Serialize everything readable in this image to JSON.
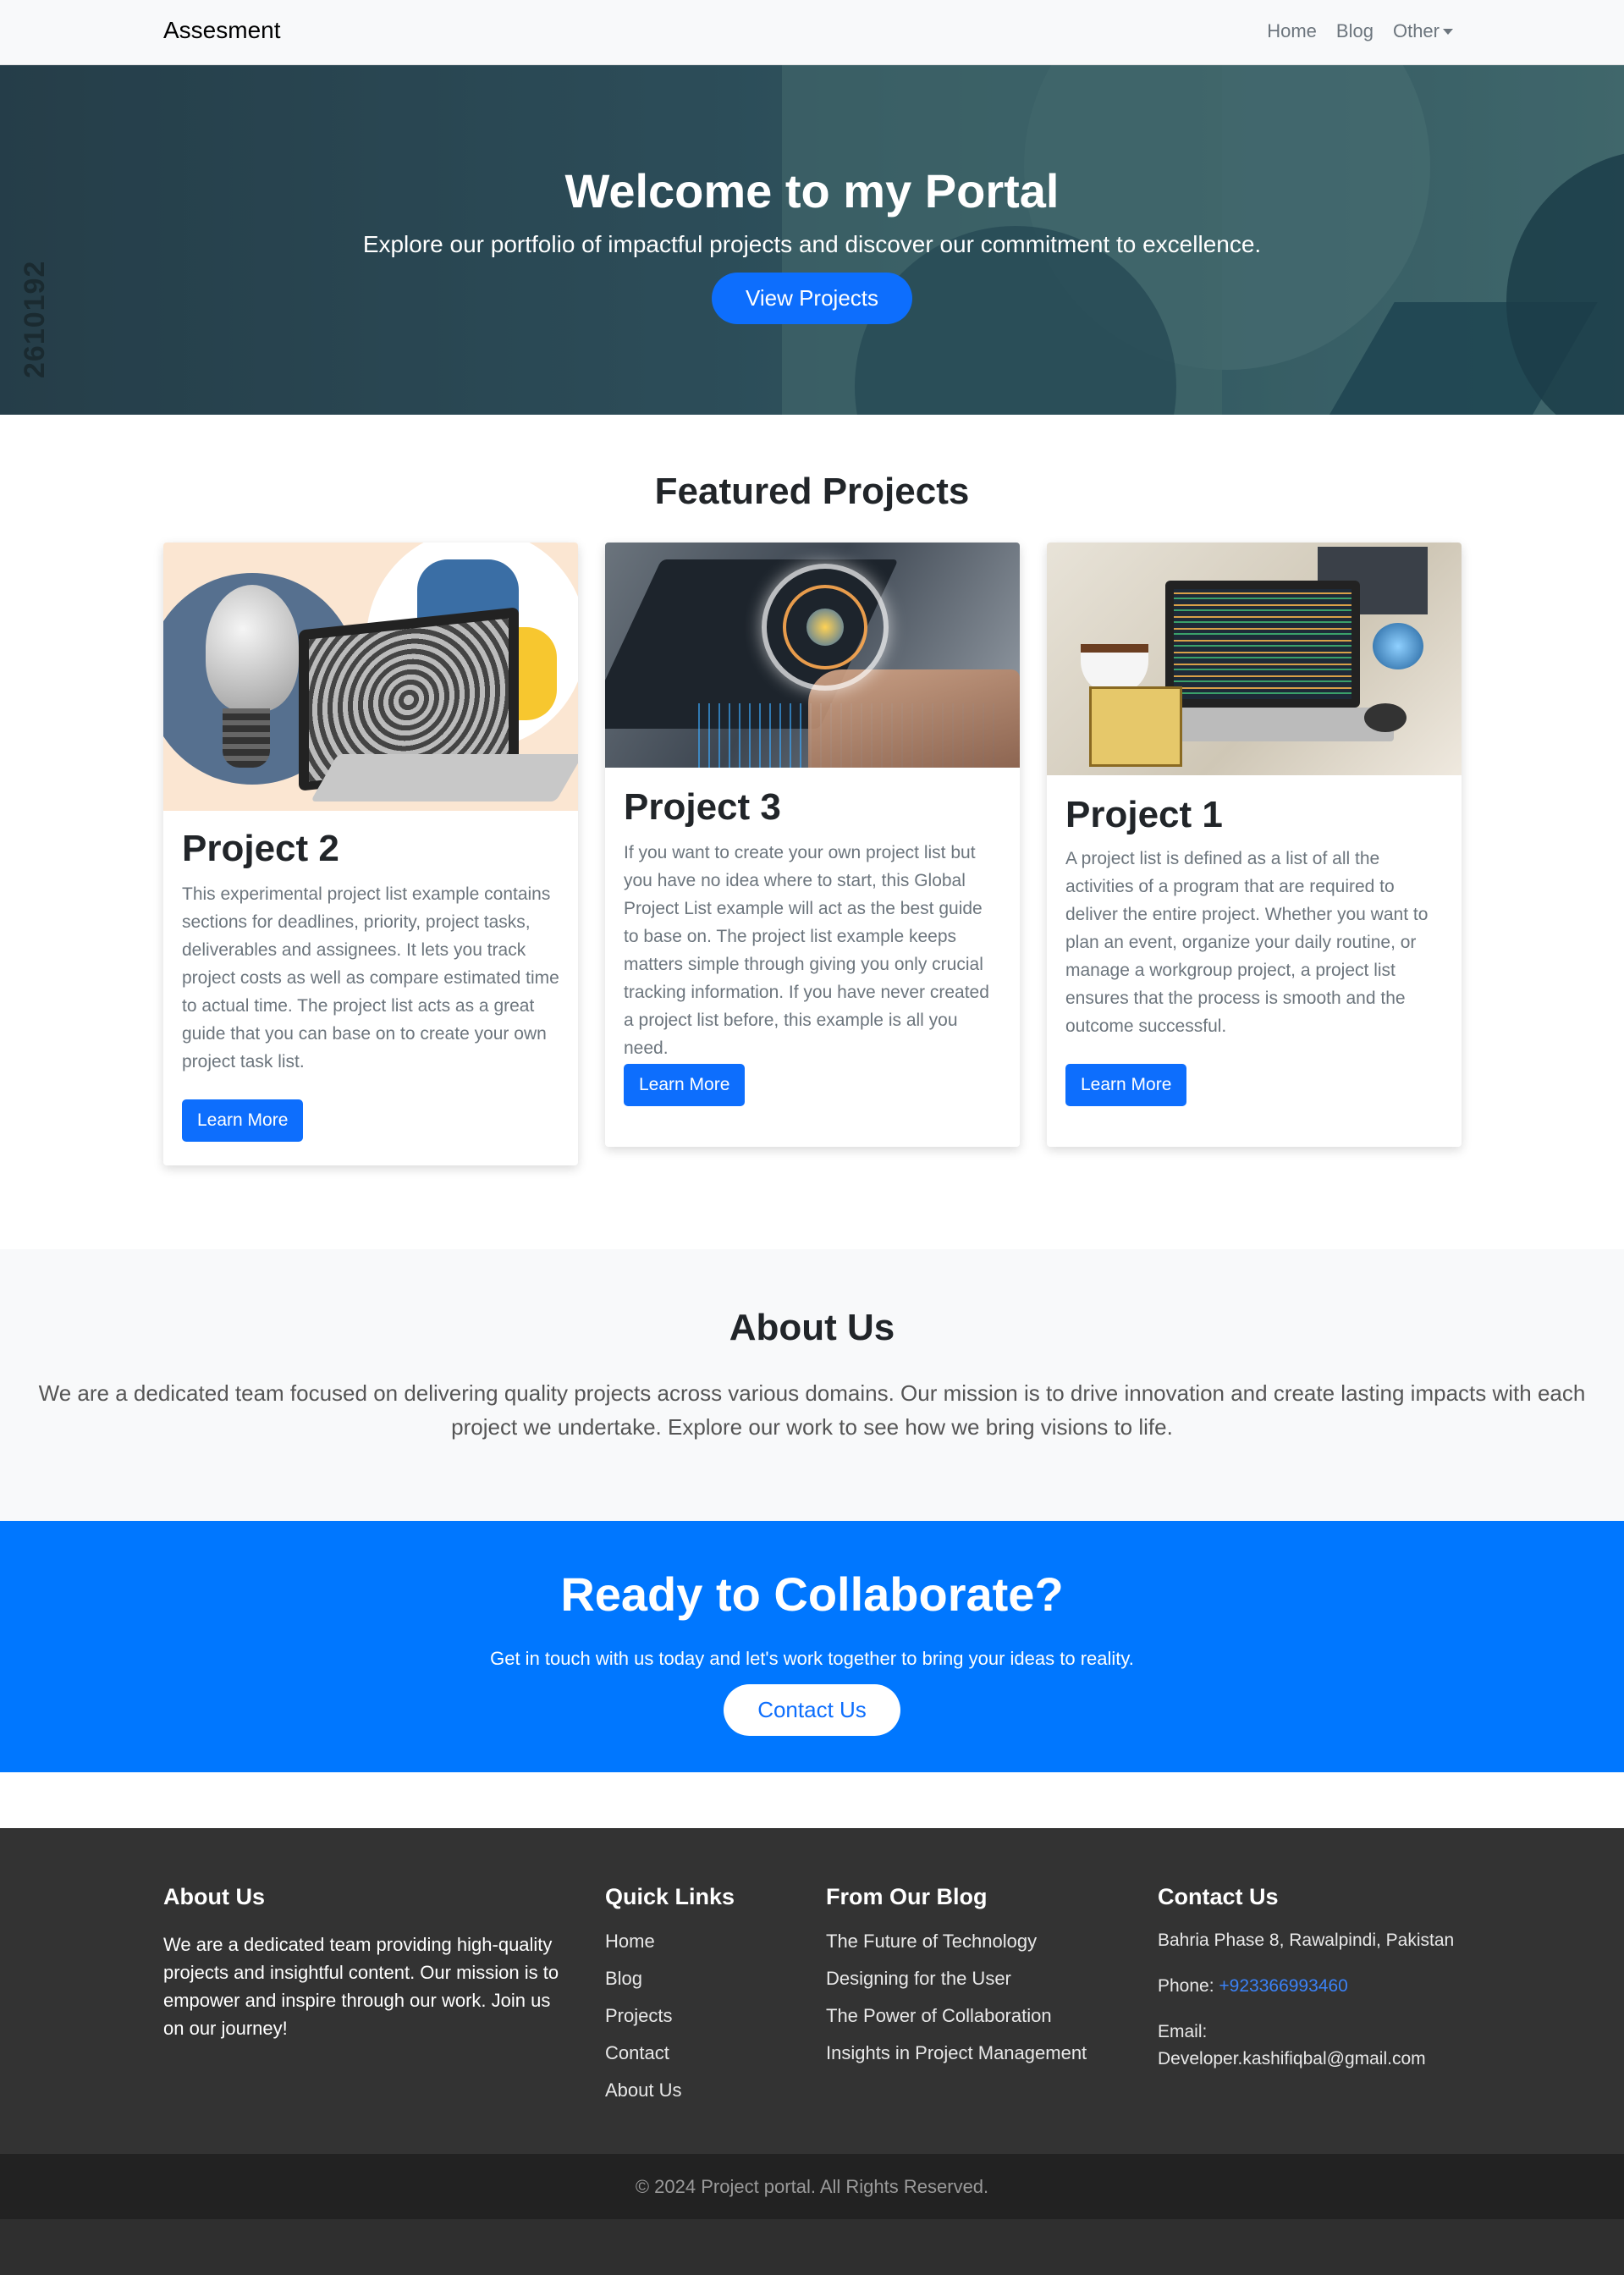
{
  "navbar": {
    "brand": "Assesment",
    "links": [
      "Home",
      "Blog",
      "Other"
    ]
  },
  "hero": {
    "title": "Welcome to my Portal",
    "subtitle": "Explore our portfolio of impactful projects and discover our commitment to excellence.",
    "button": "View Projects",
    "side_text": "2610192"
  },
  "featured": {
    "title": "Featured Projects",
    "cards": [
      {
        "title": "Project 2",
        "text": "This experimental project list example contains sections for deadlines, priority, project tasks, deliverables and assignees. It lets you track project costs as well as compare estimated time to actual time.  The project list acts as a great guide that you can base on to create your own project task list.",
        "button": "Learn More"
      },
      {
        "title": "Project 3",
        "text": "If you want to create your own project list but you have no idea where to start, this Global Project List example will act as the best guide to base on. The project list example keeps matters simple through giving you only crucial tracking information. If you have never created a project list before, this example is all you need.",
        "button": "Learn More"
      },
      {
        "title": "Project 1",
        "text": "A project list is defined as a list of all the activities of a program that are required to deliver the entire project. Whether you want to plan an event, organize your daily routine, or manage a workgroup project, a project list ensures that the process is smooth and the outcome successful.",
        "button": "Learn More"
      }
    ]
  },
  "about": {
    "title": "About Us",
    "text": "We are a dedicated team focused on delivering quality projects across various domains. Our mission is to drive innovation and create lasting impacts with each project we undertake. Explore our work to see how we bring visions to life."
  },
  "cta": {
    "title": "Ready to Collaborate?",
    "subtitle": "Get in touch with us today and let's work together to bring your ideas to reality.",
    "button": "Contact Us"
  },
  "footer": {
    "about": {
      "title": "About Us",
      "text": "We are a dedicated team providing high-quality projects and insightful content. Our mission is to empower and inspire through our work. Join us on our journey!"
    },
    "quick_links": {
      "title": "Quick Links",
      "items": [
        "Home",
        "Blog",
        "Projects",
        "Contact",
        "About Us"
      ]
    },
    "blog": {
      "title": "From Our Blog",
      "items": [
        "The Future of Technology",
        "Designing for the User",
        "The Power of Collaboration",
        "Insights in Project Management"
      ]
    },
    "contact": {
      "title": "Contact Us",
      "address": "Bahria Phase 8, Rawalpindi, Pakistan",
      "phone_label": "Phone: ",
      "phone": "+923366993460",
      "email_label": "Email:",
      "email": "Developer.kashifiqbal@gmail.com"
    },
    "copyright": "© 2024 Project portal. All Rights Reserved."
  },
  "colors": {
    "primary": "#0d6efd",
    "cta_bg": "#0077ff",
    "footer_bg": "#333333",
    "icons": [
      "chevron-down-icon"
    ]
  }
}
